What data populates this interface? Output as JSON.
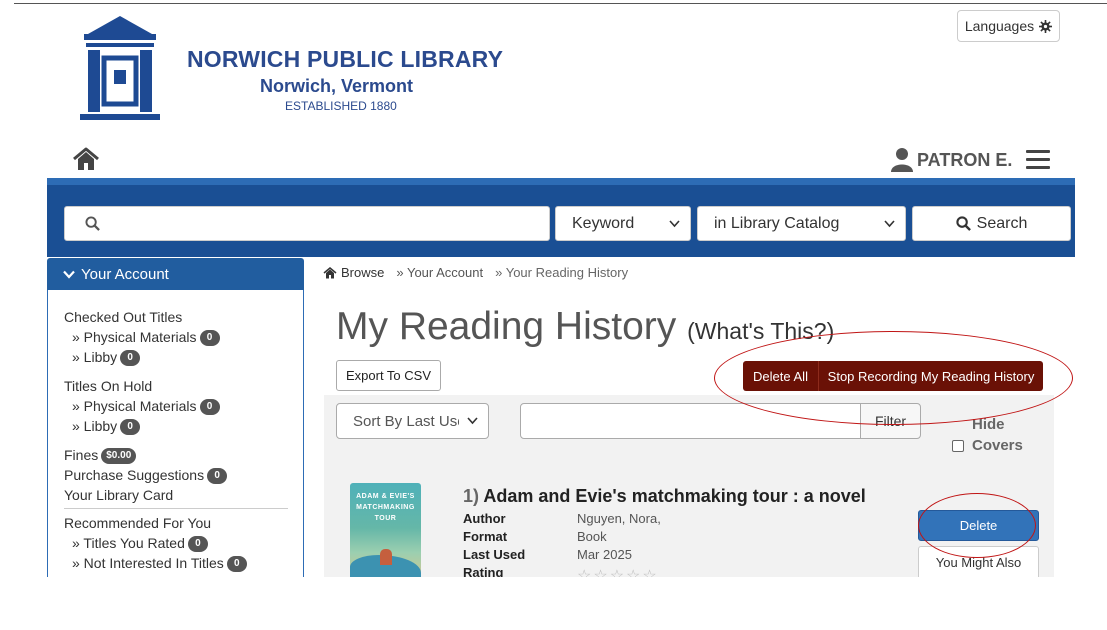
{
  "header": {
    "library_name": "NORWICH PUBLIC LIBRARY",
    "town": "Norwich, Vermont",
    "established": "ESTABLISHED 1880",
    "languages_label": "Languages",
    "patron_name": "PATRON E."
  },
  "search": {
    "placeholder": "",
    "type_selected": "Keyword",
    "scope_selected": "in Library Catalog",
    "button_label": "Search"
  },
  "sidebar": {
    "header": "Your Account",
    "checked_out": {
      "label": "Checked Out Titles",
      "physical_label": "» Physical Materials",
      "physical_count": "0",
      "libby_label": "» Libby",
      "libby_count": "0"
    },
    "on_hold": {
      "label": "Titles On Hold",
      "physical_label": "» Physical Materials",
      "physical_count": "0",
      "libby_label": "» Libby",
      "libby_count": "0"
    },
    "fines_label": "Fines",
    "fines_amount": "$0.00",
    "purchase_label": "Purchase Suggestions",
    "purchase_count": "0",
    "library_card": "Your Library Card",
    "recommended_label": "Recommended For You",
    "rated_label": "» Titles You Rated",
    "rated_count": "0",
    "not_interested_label": "» Not Interested In Titles",
    "not_interested_count": "0"
  },
  "breadcrumb": {
    "browse": "Browse",
    "account": "» Your Account",
    "current": "» Your Reading History"
  },
  "main": {
    "title": "My Reading History",
    "whats_this": "(What's This?)",
    "export_label": "Export To CSV",
    "delete_all_label": "Delete All",
    "stop_label": "Stop Recording My Reading History",
    "sort_selected": "Sort By Last Use",
    "filter_label": "Filter",
    "hide_label": "Hide",
    "covers_label": "Covers"
  },
  "records": [
    {
      "number": "1)",
      "title": "Adam and Evie's matchmaking tour : a novel",
      "author_label": "Author",
      "author": "Nguyen, Nora,",
      "format_label": "Format",
      "format": "Book",
      "last_used_label": "Last Used",
      "last_used": "Mar 2025",
      "rating_label": "Rating",
      "cover_text": "ADAM & EVIE'S MATCHMAKING TOUR",
      "delete_label": "Delete",
      "maybe_label": "You Might Also"
    }
  ],
  "colors": {
    "brand_blue": "#1a4f94",
    "accent_blue": "#2d6cb5",
    "danger_dark": "#6a1106",
    "annotation_red": "#c01515"
  }
}
